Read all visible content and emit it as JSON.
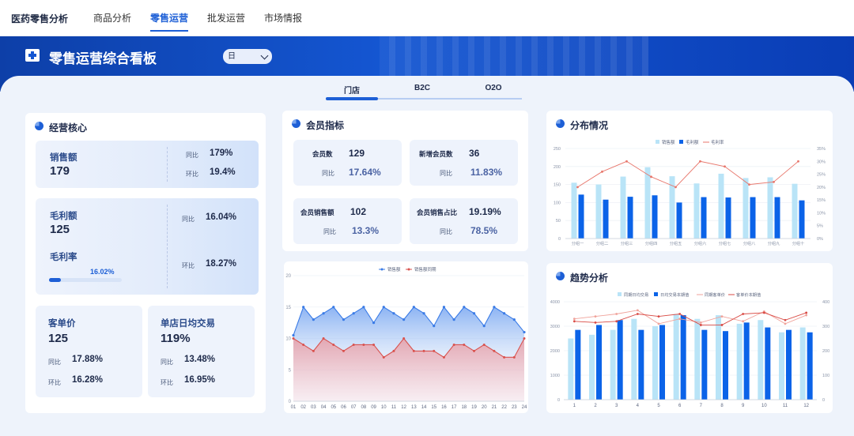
{
  "app": {
    "brand": "医药零售分析"
  },
  "nav": {
    "tabs": [
      "商品分析",
      "零售运营",
      "批发运营",
      "市场情报"
    ],
    "active": 1
  },
  "banner": {
    "title": "零售运营综合看板",
    "period": "日"
  },
  "store_tabs": {
    "items": [
      "门店",
      "B2C",
      "O2O"
    ],
    "active": 0
  },
  "core": {
    "title": "经营核心",
    "sales": {
      "label": "销售额",
      "value": "179",
      "yoy_label": "同比",
      "yoy": "179%",
      "mom_label": "环比",
      "mom": "19.4%"
    },
    "gross": {
      "label": "毛利额",
      "value": "125",
      "yoy_label": "同比",
      "yoy": "16.04%",
      "rate_label": "毛利率",
      "rate": "16.02%",
      "rate_fraction": 0.16,
      "mom_label": "环比",
      "mom": "18.27%"
    },
    "ticket": {
      "label": "客单价",
      "value": "125",
      "yoy_label": "同比",
      "yoy": "17.88%",
      "mom_label": "环比",
      "mom": "16.28%"
    },
    "daily": {
      "label": "单店日均交易",
      "value": "119%",
      "yoy_label": "同比",
      "yoy": "13.48%",
      "mom_label": "环比",
      "mom": "16.95%"
    }
  },
  "member": {
    "title": "会员指标",
    "cards": [
      {
        "label": "会员数",
        "value": "129",
        "sub_label": "同比",
        "sub": "17.64%"
      },
      {
        "label": "新增会员数",
        "value": "36",
        "sub_label": "同比",
        "sub": "11.83%"
      },
      {
        "label": "会员销售额",
        "value": "102",
        "sub_label": "同比",
        "sub": "13.3%"
      },
      {
        "label": "会员销售占比",
        "value": "19.19%",
        "sub_label": "同比",
        "sub": "78.5%"
      }
    ]
  },
  "colors": {
    "primary": "#1d5fd6",
    "light_bar": "#b9e4f7",
    "dark_bar": "#0b63e8",
    "red": "#e8766b",
    "area_blue": "#3a7be6",
    "area_red": "#d9534f"
  },
  "chart_data": [
    {
      "type": "area",
      "id": "trend-small",
      "legend": [
        "销售额",
        "销售额同期"
      ],
      "x": [
        "01",
        "02",
        "03",
        "04",
        "05",
        "06",
        "07",
        "08",
        "09",
        "10",
        "11",
        "12",
        "13",
        "14",
        "15",
        "16",
        "17",
        "18",
        "19",
        "20",
        "21",
        "22",
        "23",
        "24"
      ],
      "xtick_labels": [
        "01",
        "02",
        "03",
        "04",
        "05",
        "06",
        "07",
        "08",
        "09",
        "10",
        "11",
        "12",
        "13",
        "14",
        "15",
        "16",
        "17",
        "18",
        "19",
        "20",
        "21",
        "22",
        "23",
        "24"
      ],
      "series": [
        {
          "name": "销售额",
          "values": [
            10.5,
            15,
            13,
            14,
            15,
            13,
            14,
            15,
            12.5,
            15,
            14,
            13,
            15,
            14,
            12,
            15,
            13,
            15,
            14,
            12,
            15,
            14,
            13,
            11
          ]
        },
        {
          "name": "销售额同期",
          "values": [
            10,
            9,
            8,
            10,
            9,
            8,
            9,
            9,
            9,
            7,
            8,
            10,
            8,
            8,
            8,
            7,
            9,
            9,
            8,
            9,
            8,
            7,
            7,
            10
          ]
        }
      ],
      "ylim": [
        0,
        20
      ],
      "yticks": [
        0,
        5,
        10,
        15,
        20
      ]
    },
    {
      "type": "bar",
      "id": "distribution",
      "title": "分布情况",
      "legend": [
        "销售额",
        "毛利额",
        "毛利率"
      ],
      "categories": [
        "分组一",
        "分组二",
        "分组三",
        "分组四",
        "分组五",
        "分组六",
        "分组七",
        "分组八",
        "分组九",
        "分组十"
      ],
      "series": [
        {
          "name": "销售额",
          "values": [
            155,
            150,
            172,
            198,
            173,
            153,
            180,
            168,
            170,
            152
          ]
        },
        {
          "name": "毛利额",
          "values": [
            122,
            108,
            116,
            120,
            100,
            115,
            114,
            115,
            115,
            106
          ]
        },
        {
          "name": "毛利率",
          "values": [
            0.2,
            0.26,
            0.3,
            0.24,
            0.2,
            0.3,
            0.28,
            0.21,
            0.22,
            0.3
          ]
        }
      ],
      "ylim": [
        0,
        250
      ],
      "yticks": [
        0,
        50,
        100,
        150,
        200,
        250
      ],
      "y2lim": [
        0,
        0.35
      ],
      "y2ticks": [
        "0%",
        "5%",
        "10%",
        "15%",
        "20%",
        "25%",
        "30%",
        "35%"
      ]
    },
    {
      "type": "bar",
      "id": "trend-analysis",
      "title": "趋势分析",
      "legend": [
        "同期日均交易",
        "日均交易本期值",
        "同期客单价",
        "客单价本期值"
      ],
      "categories": [
        "1",
        "2",
        "3",
        "4",
        "5",
        "6",
        "7",
        "8",
        "9",
        "10",
        "11",
        "12"
      ],
      "series": [
        {
          "name": "同期日均交易",
          "values": [
            2500,
            2650,
            2850,
            3300,
            3000,
            3500,
            3300,
            3450,
            3100,
            3250,
            2750,
            2950
          ]
        },
        {
          "name": "日均交易本期值",
          "values": [
            2850,
            3050,
            3250,
            2850,
            3050,
            3450,
            2850,
            2800,
            3150,
            2950,
            2850,
            2750
          ]
        },
        {
          "name": "同期客单价",
          "values": [
            330,
            340,
            350,
            365,
            310,
            330,
            315,
            340,
            320,
            360,
            310,
            345
          ]
        },
        {
          "name": "客单价本期值",
          "values": [
            320,
            315,
            320,
            350,
            340,
            350,
            305,
            305,
            350,
            355,
            325,
            355
          ]
        }
      ],
      "ylim": [
        0,
        4000
      ],
      "yticks": [
        0,
        1000,
        2000,
        3000,
        4000
      ],
      "y2lim": [
        0,
        400
      ],
      "y2ticks": [
        0,
        100,
        200,
        300,
        400
      ]
    }
  ]
}
